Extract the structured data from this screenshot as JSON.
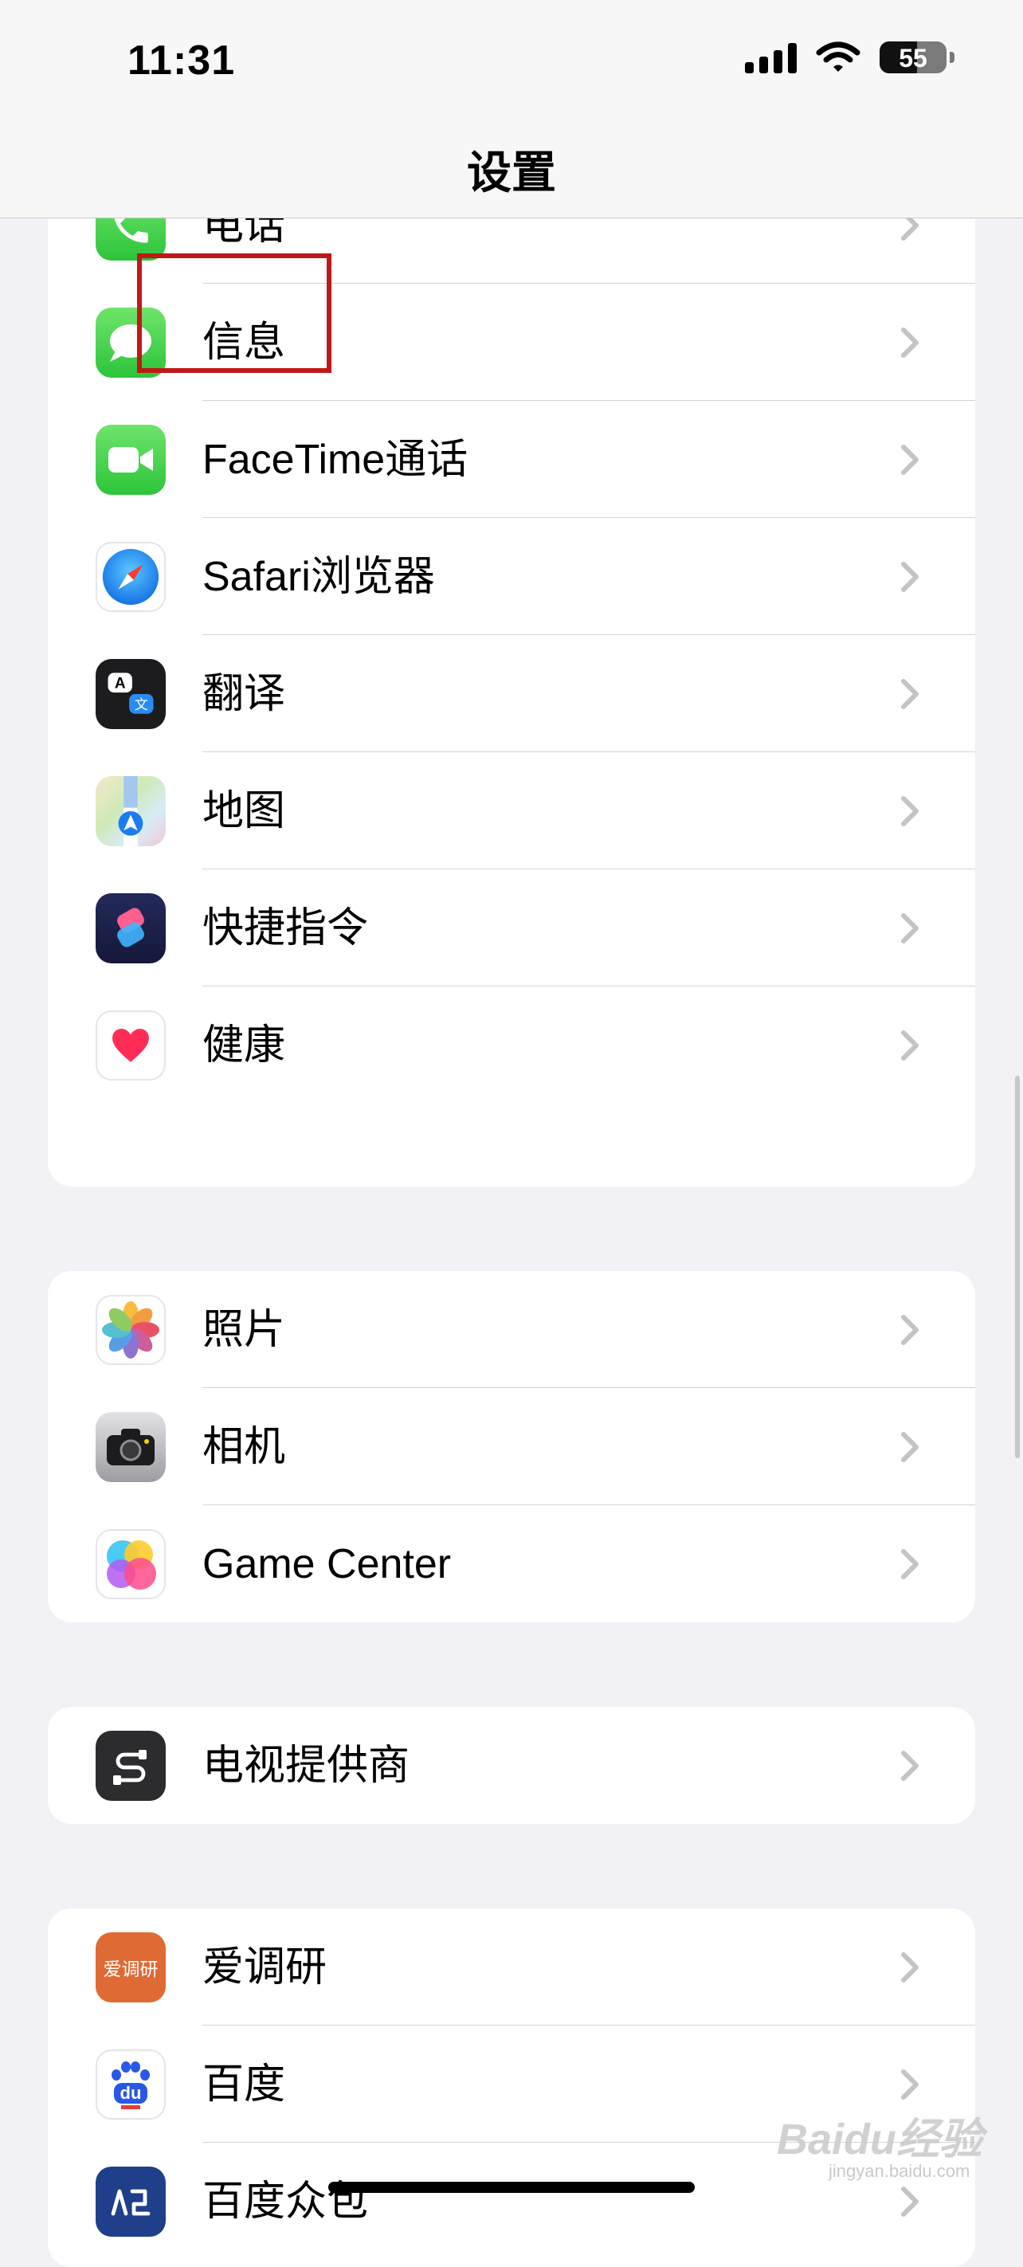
{
  "status_bar": {
    "time": "11:31",
    "battery": "55"
  },
  "nav": {
    "title": "设置"
  },
  "groups": [
    {
      "items": [
        {
          "label": "电话",
          "icon": "phone-icon"
        },
        {
          "label": "信息",
          "icon": "messages-icon"
        },
        {
          "label": "FaceTime通话",
          "icon": "facetime-icon"
        },
        {
          "label": "Safari浏览器",
          "icon": "safari-icon"
        },
        {
          "label": "翻译",
          "icon": "translate-icon"
        },
        {
          "label": "地图",
          "icon": "maps-icon"
        },
        {
          "label": "快捷指令",
          "icon": "shortcuts-icon"
        },
        {
          "label": "健康",
          "icon": "health-icon"
        }
      ]
    },
    {
      "items": [
        {
          "label": "照片",
          "icon": "photos-icon"
        },
        {
          "label": "相机",
          "icon": "camera-icon"
        },
        {
          "label": "Game Center",
          "icon": "game-center-icon"
        }
      ]
    },
    {
      "items": [
        {
          "label": "电视提供商",
          "icon": "tv-provider-icon"
        }
      ]
    },
    {
      "items": [
        {
          "label": "爱调研",
          "icon": "aidiaoyan-icon",
          "icon_text": "爱调研"
        },
        {
          "label": "百度",
          "icon": "baidu-icon",
          "icon_text": "du"
        },
        {
          "label": "百度众包",
          "icon": "baidu-zhongbao-icon"
        }
      ]
    }
  ],
  "watermark": {
    "text": "Baidu经验",
    "sub": "jingyan.baidu.com"
  }
}
